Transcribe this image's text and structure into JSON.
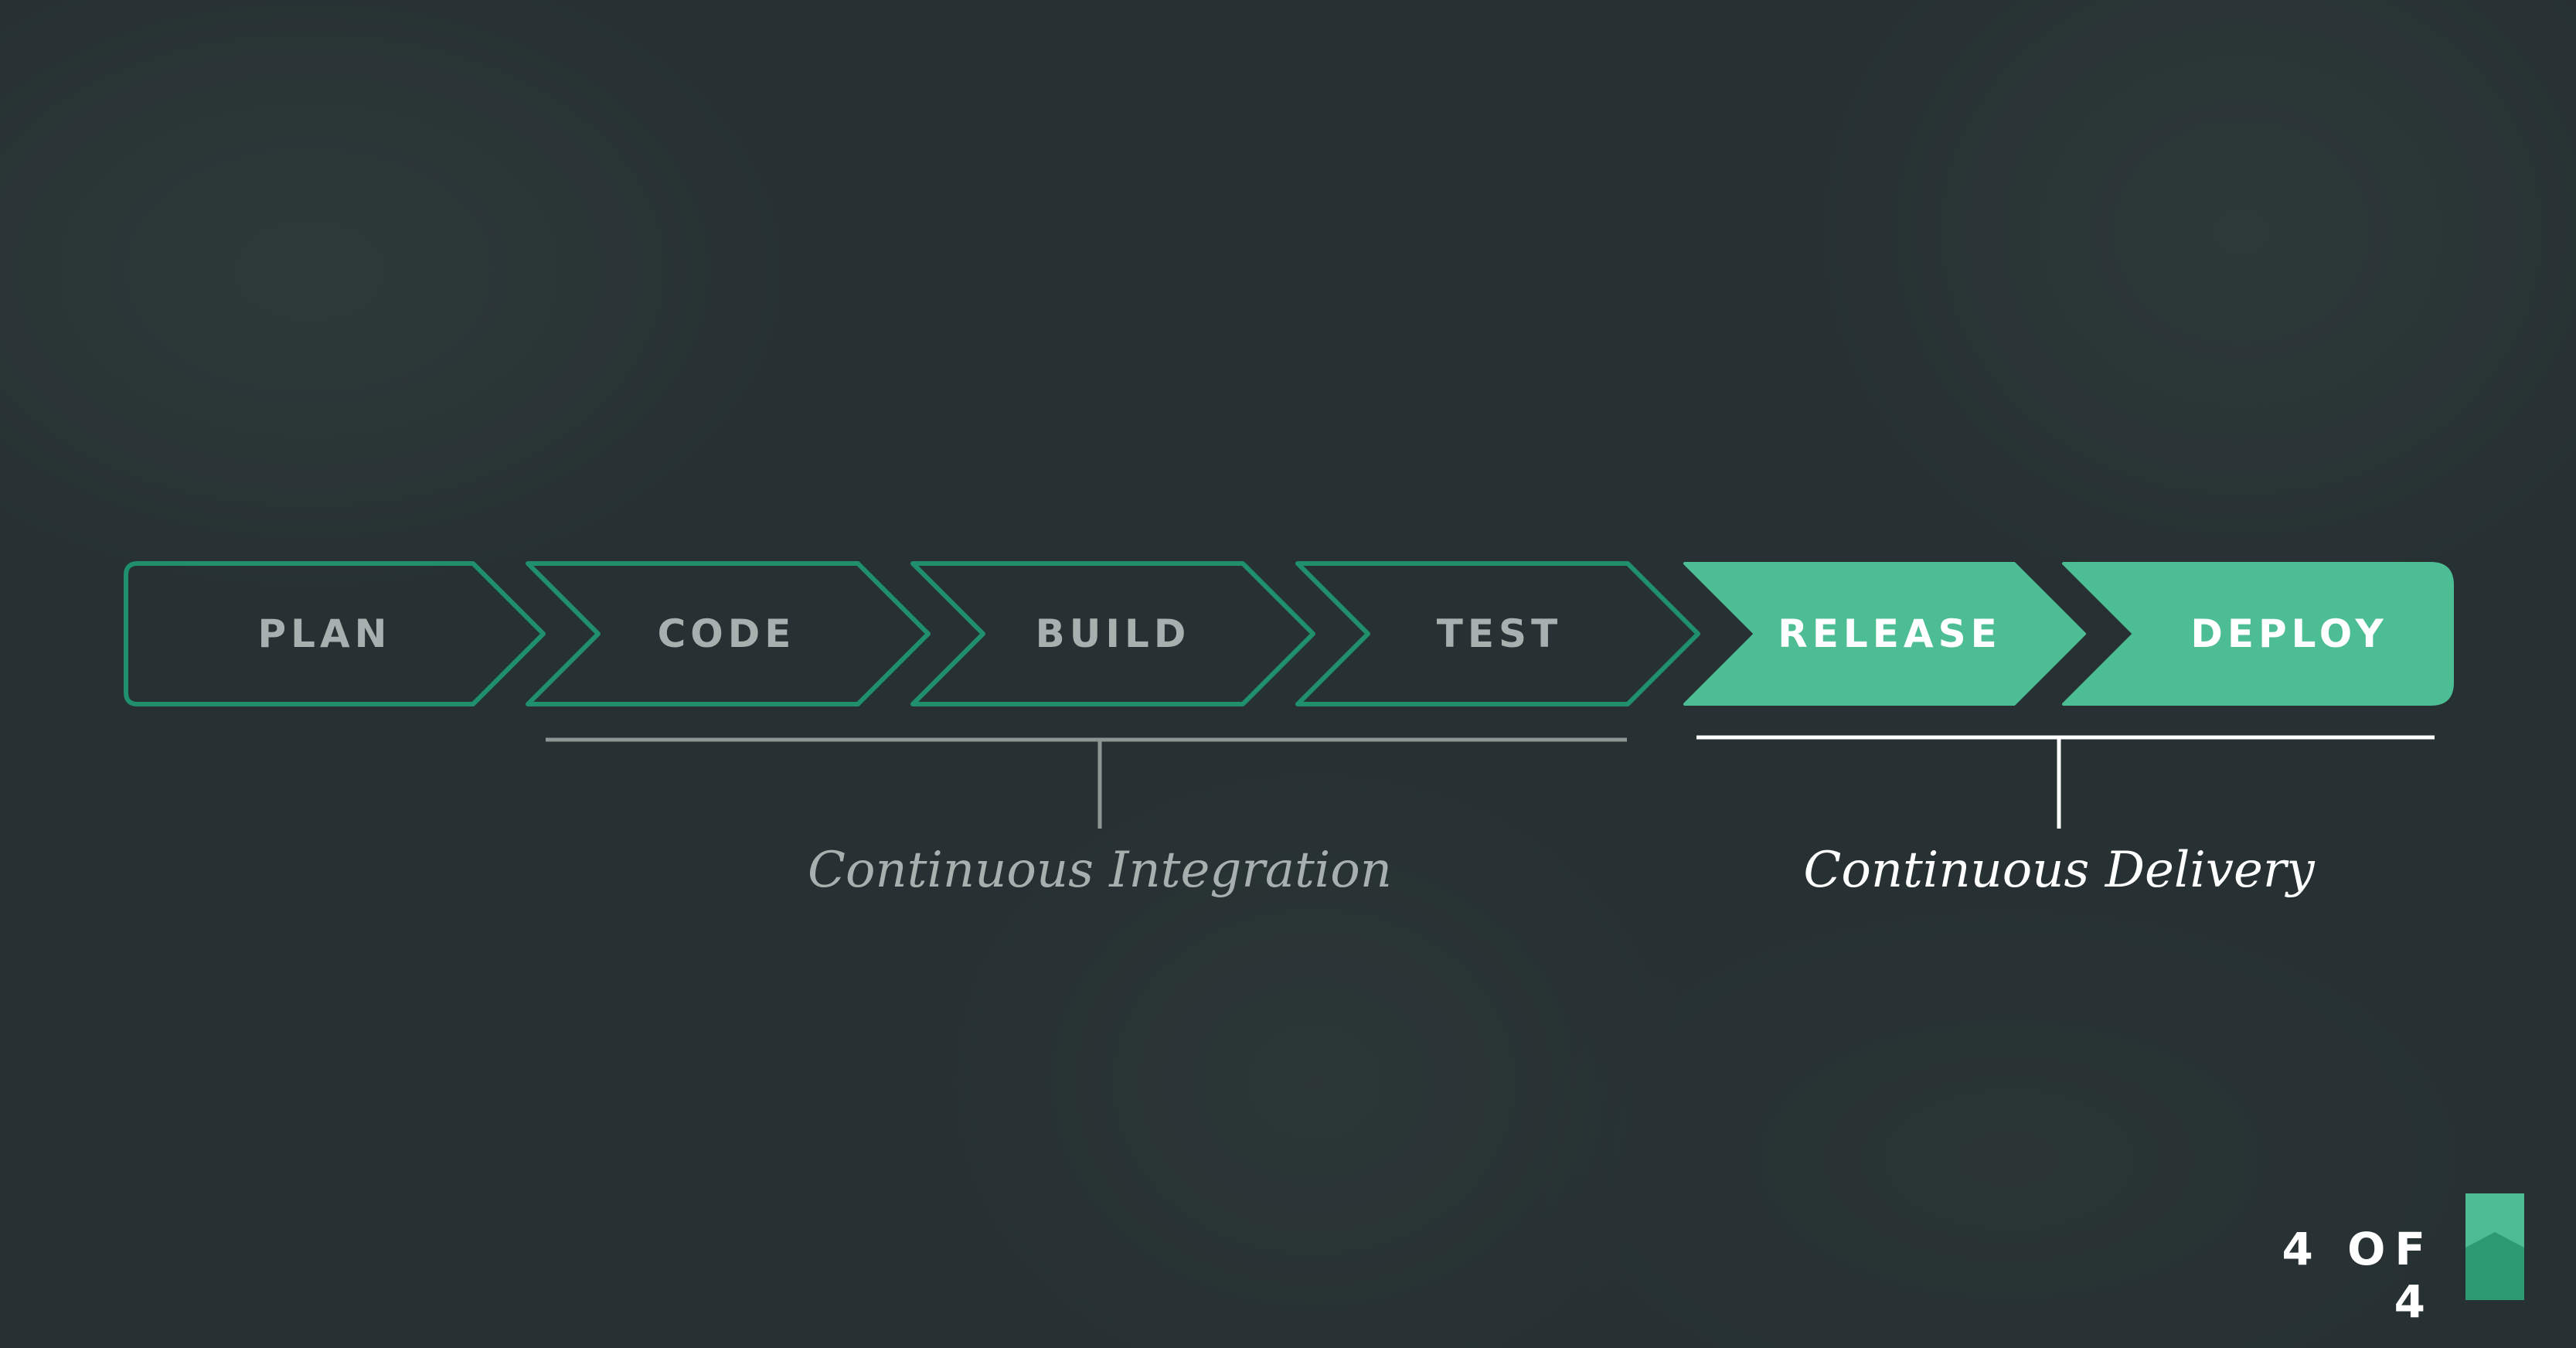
{
  "pipeline": {
    "steps": [
      {
        "label": "PLAN",
        "active": false
      },
      {
        "label": "CODE",
        "active": false
      },
      {
        "label": "BUILD",
        "active": false
      },
      {
        "label": "TEST",
        "active": false
      },
      {
        "label": "RELEASE",
        "active": true
      },
      {
        "label": "DEPLOY",
        "active": true
      }
    ],
    "groups": [
      {
        "label": "Continuous Integration"
      },
      {
        "label": "Continuous Delivery"
      }
    ]
  },
  "footer": {
    "page_indicator": "4 OF 4",
    "bookmark_icon": "bookmark-icon"
  },
  "colors": {
    "background": "#273133",
    "accent": "#4dbd94",
    "outline": "#1f8f6c",
    "inactive_text": "#a7b0ae",
    "ci_bracket": "#8e9694",
    "cd_bracket": "#ffffff"
  }
}
